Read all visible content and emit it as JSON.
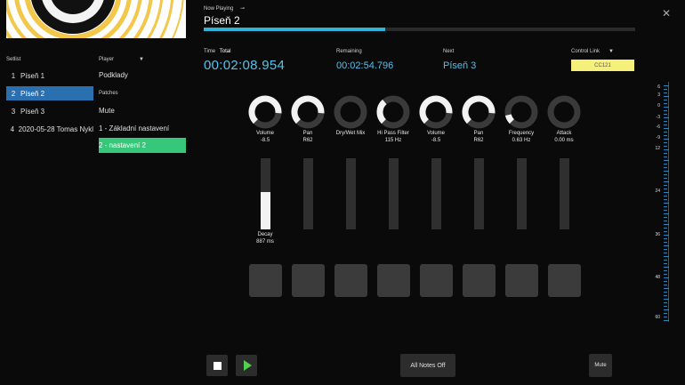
{
  "setlist": {
    "title": "Setlist",
    "items": [
      {
        "index": "1",
        "name": "Píseň 1",
        "active": false
      },
      {
        "index": "2",
        "name": "Píseň 2",
        "active": true
      },
      {
        "index": "3",
        "name": "Píseň 3",
        "active": false
      },
      {
        "index": "4",
        "name": "2020-05-28 Tomas Nykl",
        "active": false
      }
    ]
  },
  "player": {
    "title": "Player",
    "value": "Podklady"
  },
  "patches": {
    "title": "Patches",
    "items": [
      {
        "name": "Mute",
        "active": false
      },
      {
        "name": "1 - Základní nastavení",
        "active": false
      },
      {
        "name": "2 - nastavení 2",
        "active": true
      }
    ]
  },
  "now_playing": {
    "label": "Now Playing",
    "icon": "link-icon",
    "title": "Píseň 2",
    "progress": 0.42
  },
  "time": {
    "label": "Time",
    "label_total": "Total",
    "value": "00:02:08.954"
  },
  "remaining": {
    "label": "Remaining",
    "value": "00:02:54.796"
  },
  "next": {
    "label": "Next",
    "value": "Píseň 3"
  },
  "control_link": {
    "label": "Control Link",
    "value": "CC121"
  },
  "knobs": [
    {
      "name": "Volume",
      "value": "-8.5",
      "level": 0.85
    },
    {
      "name": "Pan",
      "value": "R62",
      "level": 0.85
    },
    {
      "name": "Dry/Wet Mix",
      "value": "",
      "level": 0.0
    },
    {
      "name": "Hi Pass Filter",
      "value": "115 Hz",
      "level": 0.35
    },
    {
      "name": "Volume",
      "value": "-8.5",
      "level": 0.85
    },
    {
      "name": "Pan",
      "value": "R62",
      "level": 0.85
    },
    {
      "name": "Frequency",
      "value": "0.63 Hz",
      "level": 0.12
    },
    {
      "name": "Attack",
      "value": "0.00 ms",
      "level": 0.0
    }
  ],
  "faders": [
    {
      "name": "Decay",
      "value": "887 ms",
      "level": 0.52
    },
    {
      "name": "",
      "value": "",
      "level": 0
    },
    {
      "name": "",
      "value": "",
      "level": 0
    },
    {
      "name": "",
      "value": "",
      "level": 0
    },
    {
      "name": "",
      "value": "",
      "level": 0
    },
    {
      "name": "",
      "value": "",
      "level": 0
    },
    {
      "name": "",
      "value": "",
      "level": 0
    },
    {
      "name": "",
      "value": "",
      "level": 0
    }
  ],
  "transport": {
    "all_notes_off": "All Notes Off",
    "mute": "Mute"
  },
  "meter": {
    "labels": [
      "6",
      "3",
      "0",
      "-3",
      "-6",
      "-9",
      "12",
      "24",
      "36",
      "48",
      "60"
    ]
  },
  "colors": {
    "accent_blue": "#2a6fb0",
    "patch_green": "#37c77a",
    "time_cyan": "#5ac0e8",
    "control_link_yellow": "#f5f07a",
    "play_green": "#4fd14f"
  }
}
